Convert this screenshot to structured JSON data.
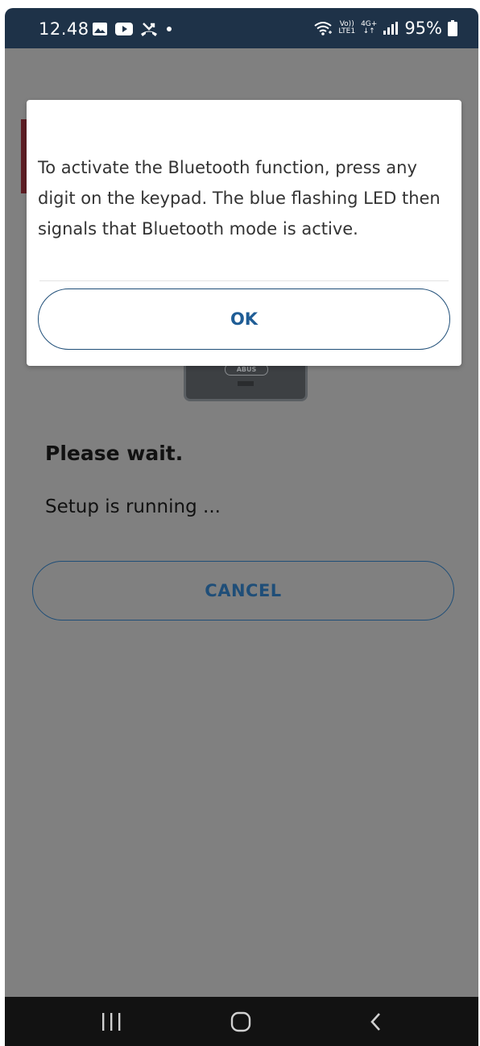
{
  "status_bar": {
    "time": "12.48",
    "battery": "95%",
    "network_top": "Vo))",
    "network_bottom": "LTE1",
    "network_type": "4G+",
    "icons": [
      "gallery-icon",
      "youtube-icon",
      "missed-call-icon",
      "dot-icon",
      "wifi-icon",
      "signal-icon",
      "battery-icon"
    ]
  },
  "dialog": {
    "message": "To activate the Bluetooth function, press any digit on the keypad. The blue flashing LED then signals that Bluetooth mode is active.",
    "ok_label": "OK"
  },
  "main": {
    "device_logo": "ABUS",
    "title": "Please wait.",
    "subtitle": "Setup is running ...",
    "cancel_label": "CANCEL"
  },
  "colors": {
    "status_bar": "#1e3248",
    "overlay": "#808080",
    "accent_blue": "#1f4e78",
    "accent_red": "#5e1d24",
    "nav_bar": "#121212"
  }
}
